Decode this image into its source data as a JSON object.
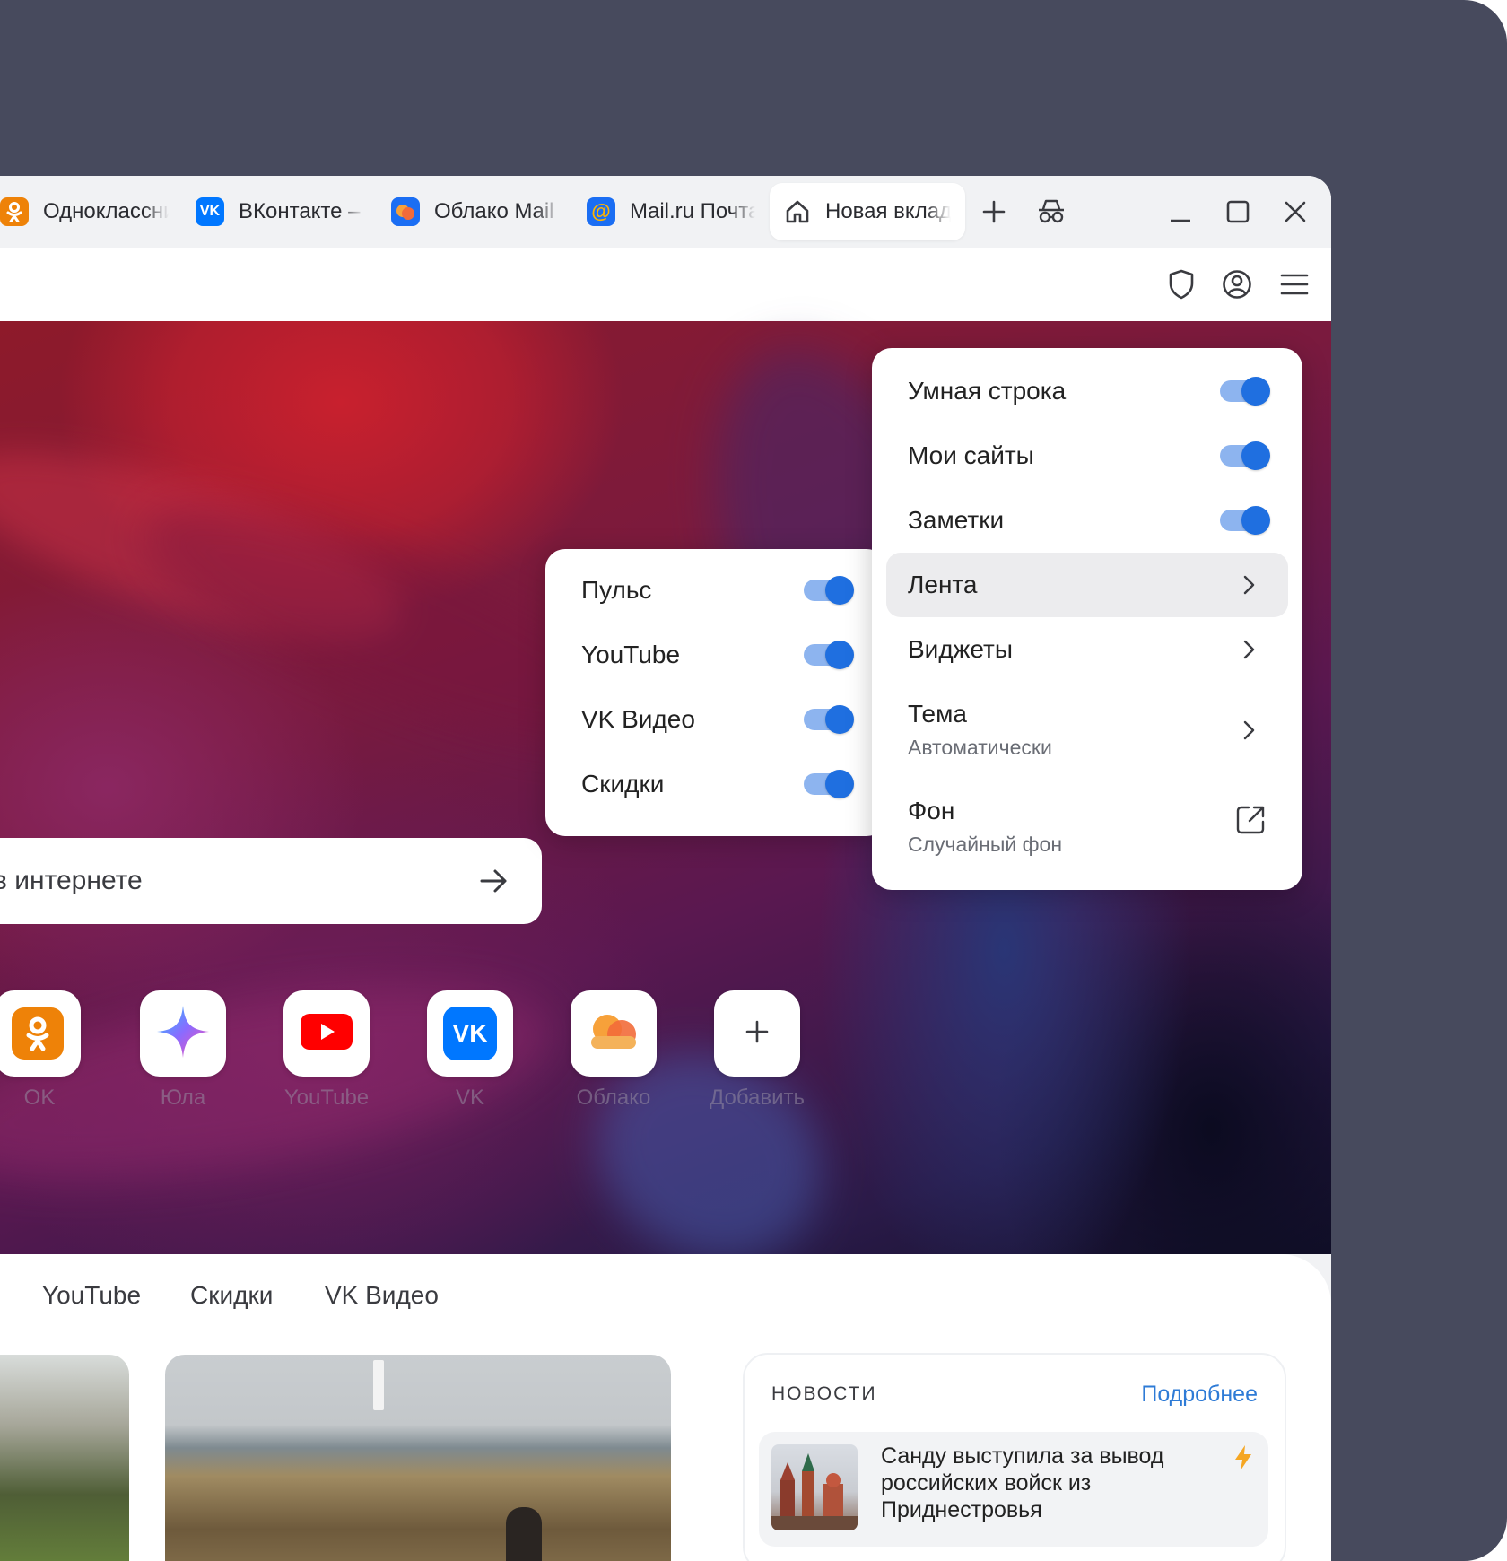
{
  "tabs": [
    {
      "title": "Одноклассники",
      "icon": "ok-icon",
      "color": "#ee8208"
    },
    {
      "title": "ВКонтакте – ",
      "icon": "vk-icon",
      "color": "#0077ff"
    },
    {
      "title": "Облако Mail",
      "icon": "cloud-icon",
      "color": "#1b6ef3"
    },
    {
      "title": "Mail.ru Почта",
      "icon": "mail-icon",
      "color": "#1b6ef3"
    },
    {
      "title": "Новая вкладка",
      "icon": "home-icon",
      "active": true
    }
  ],
  "search": {
    "text": "в интернете"
  },
  "shortcuts": [
    {
      "label": "OK",
      "icon": "ok-icon",
      "color": "#ee8208"
    },
    {
      "label": "Юла",
      "icon": "sparkle-icon"
    },
    {
      "label": "YouTube",
      "icon": "youtube-icon",
      "color": "#ff0000"
    },
    {
      "label": "VK",
      "icon": "vk-icon",
      "color": "#0077ff"
    },
    {
      "label": "Облако",
      "icon": "cloud-icon"
    },
    {
      "label": "Добавить",
      "icon": "plus-icon"
    }
  ],
  "main_menu": {
    "items": [
      {
        "label": "Умная строка",
        "toggle": true
      },
      {
        "label": "Мои сайты",
        "toggle": true
      },
      {
        "label": "Заметки",
        "toggle": true
      },
      {
        "label": "Лента",
        "submenu": true,
        "highlighted": true
      },
      {
        "label": "Виджеты",
        "submenu": true
      },
      {
        "label": "Тема",
        "sub": "Автоматически",
        "submenu": true
      },
      {
        "label": "Фон",
        "sub": "Случайный фон",
        "external": true
      }
    ]
  },
  "feed_menu": {
    "items": [
      {
        "label": "Пульс",
        "toggle": true
      },
      {
        "label": "YouTube",
        "toggle": true
      },
      {
        "label": "VK Видео",
        "toggle": true
      },
      {
        "label": "Скидки",
        "toggle": true
      }
    ]
  },
  "feed_tabs": [
    "YouTube",
    "Скидки",
    "VK Видео"
  ],
  "news": {
    "header": "НОВОСТИ",
    "more": "Подробнее",
    "item_text": "Санду выступила за вывод российских войск из Приднестровья"
  },
  "colors": {
    "accent": "#1f6fe0",
    "link": "#2e7bd6",
    "backdrop": "#474a5d"
  }
}
